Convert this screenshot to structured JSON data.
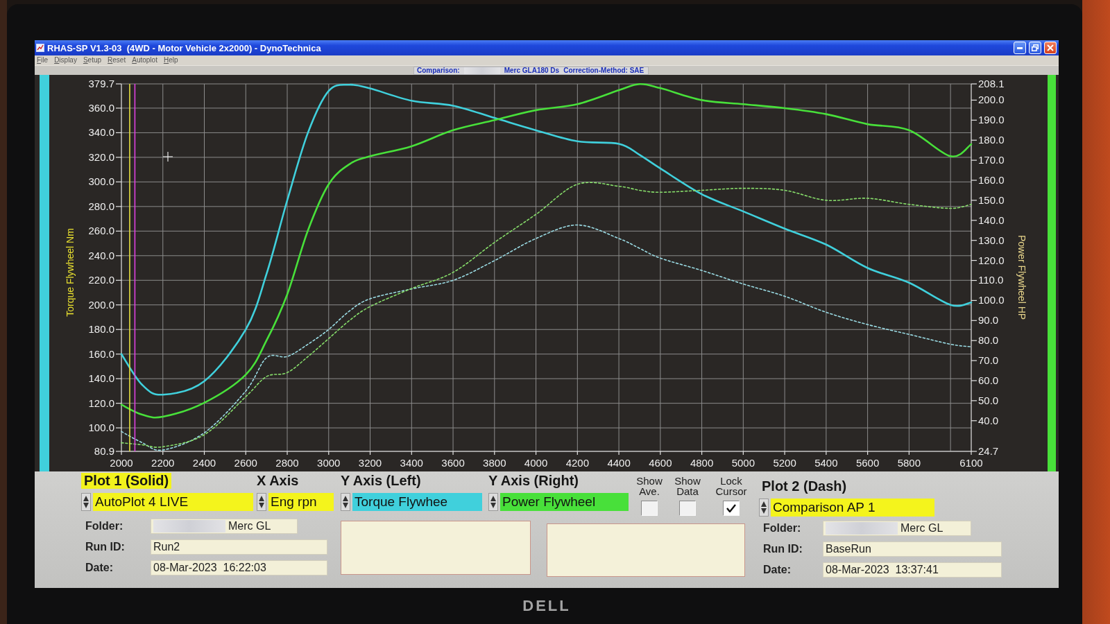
{
  "monitor": {
    "brand": "DELL"
  },
  "window": {
    "title": "RHAS-SP V1.3-03  (4WD - Motor Vehicle 2x2000) - DynoTechnica"
  },
  "menu": [
    "File",
    "Display",
    "Setup",
    "Reset",
    "Autoplot",
    "Help"
  ],
  "comparison_bar": {
    "label": "Comparison:",
    "redacted": true,
    "vehicle": "Merc GLA180 Ds",
    "correction": "Correction-Method: SAE"
  },
  "chart": {
    "chart_data": {
      "type": "line",
      "ylabel": "Torque Flywheel Nm",
      "y2label": "Power Flywheel HP",
      "grid": true,
      "x": [
        2000,
        2100,
        2200,
        2400,
        2600,
        2700,
        2800,
        2900,
        3000,
        3100,
        3200,
        3400,
        3600,
        3800,
        4000,
        4200,
        4400,
        4500,
        4600,
        4800,
        5000,
        5200,
        5400,
        5600,
        5800,
        6000,
        6100
      ],
      "xlim": [
        2000,
        6100
      ],
      "xticks": [
        2000,
        2200,
        2400,
        2600,
        2800,
        3000,
        3200,
        3400,
        3600,
        3800,
        4000,
        4200,
        4400,
        4600,
        4800,
        5000,
        5200,
        5400,
        5600,
        5800,
        6100
      ],
      "ylim": [
        80.9,
        379.7
      ],
      "yticks": [
        {
          "value": 80.9,
          "label": "80.9"
        },
        {
          "value": 100,
          "label": "100.0"
        },
        {
          "value": 120,
          "label": "120.0"
        },
        {
          "value": 140,
          "label": "140.0"
        },
        {
          "value": 160,
          "label": "160.0"
        },
        {
          "value": 180,
          "label": "180.0"
        },
        {
          "value": 200,
          "label": "200.0"
        },
        {
          "value": 220,
          "label": "220.0"
        },
        {
          "value": 240,
          "label": "240.0"
        },
        {
          "value": 260,
          "label": "260.0"
        },
        {
          "value": 280,
          "label": "280.0"
        },
        {
          "value": 300,
          "label": "300.0"
        },
        {
          "value": 320,
          "label": "320.0"
        },
        {
          "value": 340,
          "label": "340.0"
        },
        {
          "value": 360,
          "label": "360.0"
        },
        {
          "value": 379.7,
          "label": "379.7"
        }
      ],
      "y2lim": [
        24.7,
        208.1
      ],
      "y2ticks": [
        {
          "value": 24.7,
          "label": "24.7"
        },
        {
          "value": 40,
          "label": "40.0"
        },
        {
          "value": 50,
          "label": "50.0"
        },
        {
          "value": 60,
          "label": "60.0"
        },
        {
          "value": 70,
          "label": "70.0"
        },
        {
          "value": 80,
          "label": "80.0"
        },
        {
          "value": 90,
          "label": "90.0"
        },
        {
          "value": 100,
          "label": "100.0"
        },
        {
          "value": 110,
          "label": "110.0"
        },
        {
          "value": 120,
          "label": "120.0"
        },
        {
          "value": 130,
          "label": "130.0"
        },
        {
          "value": 140,
          "label": "140.0"
        },
        {
          "value": 150,
          "label": "150.0"
        },
        {
          "value": 160,
          "label": "160.0"
        },
        {
          "value": 170,
          "label": "170.0"
        },
        {
          "value": 180,
          "label": "180.0"
        },
        {
          "value": 190,
          "label": "190.0"
        },
        {
          "value": 200,
          "label": "200.0"
        },
        {
          "value": 208.1,
          "label": "208.1"
        }
      ],
      "series": [
        {
          "color": "#40d0dc",
          "line_style": "solid",
          "values": [
            160,
            135,
            127,
            138,
            180,
            225,
            285,
            340,
            374,
            379,
            376,
            366,
            362,
            352,
            342,
            333,
            331,
            322,
            311,
            290,
            276,
            262,
            249,
            230,
            218,
            200,
            202
          ]
        },
        {
          "color": "#48e03a",
          "axis": "y2",
          "line_style": "solid",
          "values": [
            48,
            43,
            42,
            49,
            63,
            80,
            103,
            135,
            158,
            168,
            172,
            177,
            185,
            190,
            195,
            198,
            205,
            208,
            206,
            200,
            198,
            196,
            193,
            188,
            185,
            172,
            178
          ]
        },
        {
          "color": "#9adbe4",
          "line_style": "dashed",
          "values": [
            97,
            88,
            82,
            96,
            130,
            157,
            158,
            168,
            180,
            195,
            205,
            213,
            220,
            236,
            254,
            265,
            254,
            246,
            238,
            228,
            217,
            207,
            194,
            184,
            176,
            168,
            166
          ]
        },
        {
          "color": "#86dc6a",
          "axis": "y2",
          "line_style": "dashed",
          "values": [
            29,
            28,
            27,
            33,
            52,
            62,
            64,
            72,
            81,
            90,
            97,
            106,
            114,
            129,
            143,
            158,
            157,
            155,
            154,
            155,
            156,
            155,
            150,
            151,
            148,
            146,
            148
          ]
        }
      ],
      "ref_lines": [
        {
          "axis": "x",
          "value": 2040,
          "color": "#e6e040"
        },
        {
          "axis": "x",
          "value": 2065,
          "color": "#e040e0"
        }
      ]
    }
  },
  "plot_1": {
    "title": "Plot 1 (Solid)",
    "selected": true,
    "source": "AutoPlot 4 LIVE",
    "folder": {
      "label": "Folder:",
      "value": "Merc GL",
      "redacted": true
    },
    "run_id": {
      "label": "Run ID:",
      "value": "Run2"
    },
    "date": {
      "label": "Date:",
      "value": "08-Mar-2023  16:22:03"
    }
  },
  "x_axis": {
    "title": "X Axis",
    "channel": "Eng rpn"
  },
  "y_axis_left": {
    "title": "Y Axis (Left)",
    "channel": "Torque Flywhee"
  },
  "y_axis_right": {
    "title": "Y Axis (Right)",
    "channel": "Power Flywheel"
  },
  "options": [
    {
      "label": "Show Ave.",
      "checked": false
    },
    {
      "label": "Show Data",
      "checked": false
    },
    {
      "label": "Lock Cursor",
      "checked": true
    }
  ],
  "plot_2": {
    "title": "Plot 2 (Dash)",
    "selected": false,
    "source": "Comparison AP 1",
    "folder": {
      "label": "Folder:",
      "value": "Merc GL",
      "redacted": true
    },
    "run_id": {
      "label": "Run ID:",
      "value": "BaseRun"
    },
    "date": {
      "label": "Date:",
      "value": "08-Mar-2023  13:37:41"
    }
  }
}
